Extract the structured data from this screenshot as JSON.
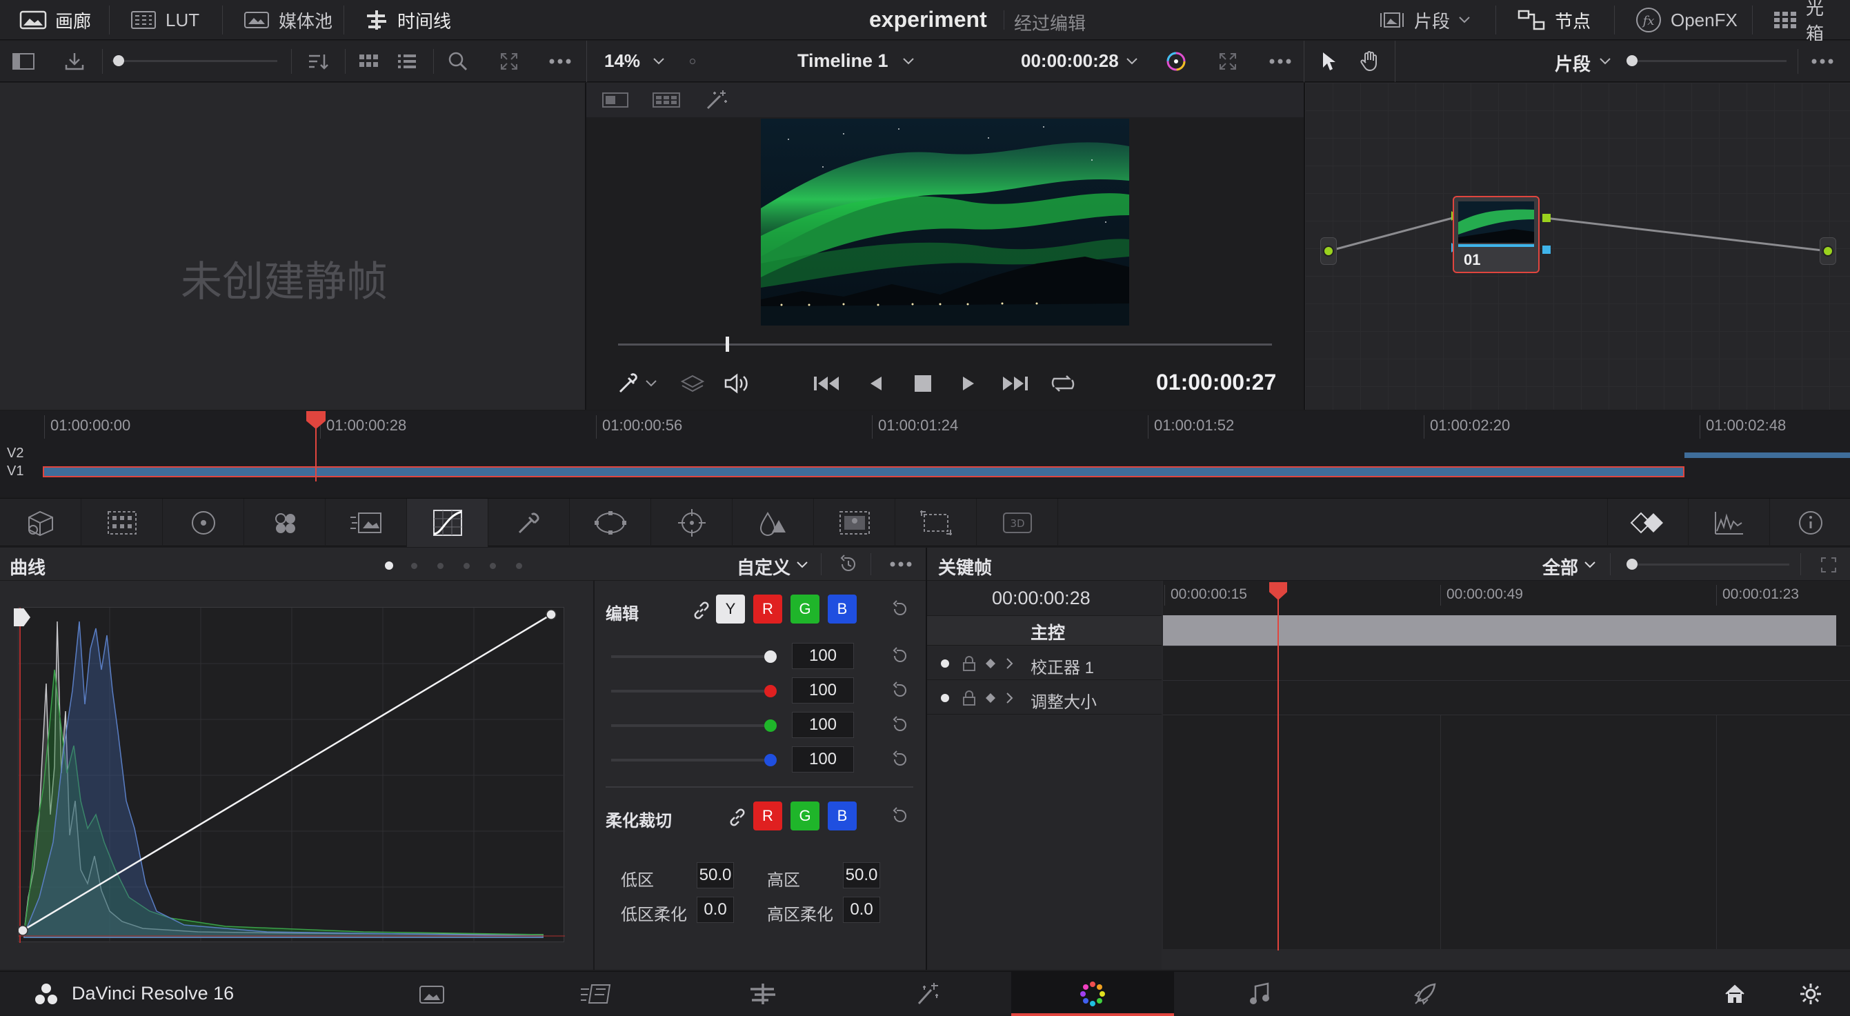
{
  "topbar": {
    "gallery_label": "画廊",
    "lut_label": "LUT",
    "media_pool_label": "媒体池",
    "timeline_label": "时间线",
    "project_title": "experiment",
    "edit_status": "经过编辑",
    "clips_label": "片段",
    "nodes_label": "节点",
    "openfx_label": "OpenFX",
    "lightbox_label": "光箱"
  },
  "viewer": {
    "zoom": "14%",
    "timeline_name": "Timeline 1",
    "source_timecode": "00:00:00:28",
    "playhead_timecode": "01:00:00:27"
  },
  "nodes_panel": {
    "mode_label": "片段",
    "node_label": "01"
  },
  "gallery": {
    "empty_text": "未创建静帧"
  },
  "timeline": {
    "ticks": [
      "01:00:00:00",
      "01:00:00:28",
      "01:00:00:56",
      "01:00:01:24",
      "01:00:01:52",
      "01:00:02:20",
      "01:00:02:48"
    ],
    "tracks": [
      "V2",
      "V1"
    ]
  },
  "curves": {
    "title": "曲线",
    "preset": "自定义",
    "edit_label": "编辑",
    "channels": [
      "Y",
      "R",
      "G",
      "B"
    ],
    "intensity": [
      "100",
      "100",
      "100",
      "100"
    ],
    "soft_clip_label": "柔化裁切",
    "soft_channels": [
      "R",
      "G",
      "B"
    ],
    "low_label": "低区",
    "low_value": "50.0",
    "high_label": "高区",
    "high_value": "50.0",
    "low_soft_label": "低区柔化",
    "low_soft_value": "0.0",
    "high_soft_label": "高区柔化",
    "high_soft_value": "0.0"
  },
  "keyframes": {
    "title": "关键帧",
    "filter": "全部",
    "current_tc": "00:00:00:28",
    "ticks": [
      "00:00:00:15",
      "00:00:00:49",
      "00:00:01:23"
    ],
    "master_label": "主控",
    "rows": [
      "校正器 1",
      "调整大小"
    ]
  },
  "bottombar": {
    "app_name": "DaVinci Resolve 16"
  },
  "colors": {
    "accent_red": "#e0453e",
    "channel_red": "#e02020",
    "channel_green": "#1fb52a",
    "channel_blue": "#1f4fe0",
    "node_green": "#9ad21e"
  }
}
